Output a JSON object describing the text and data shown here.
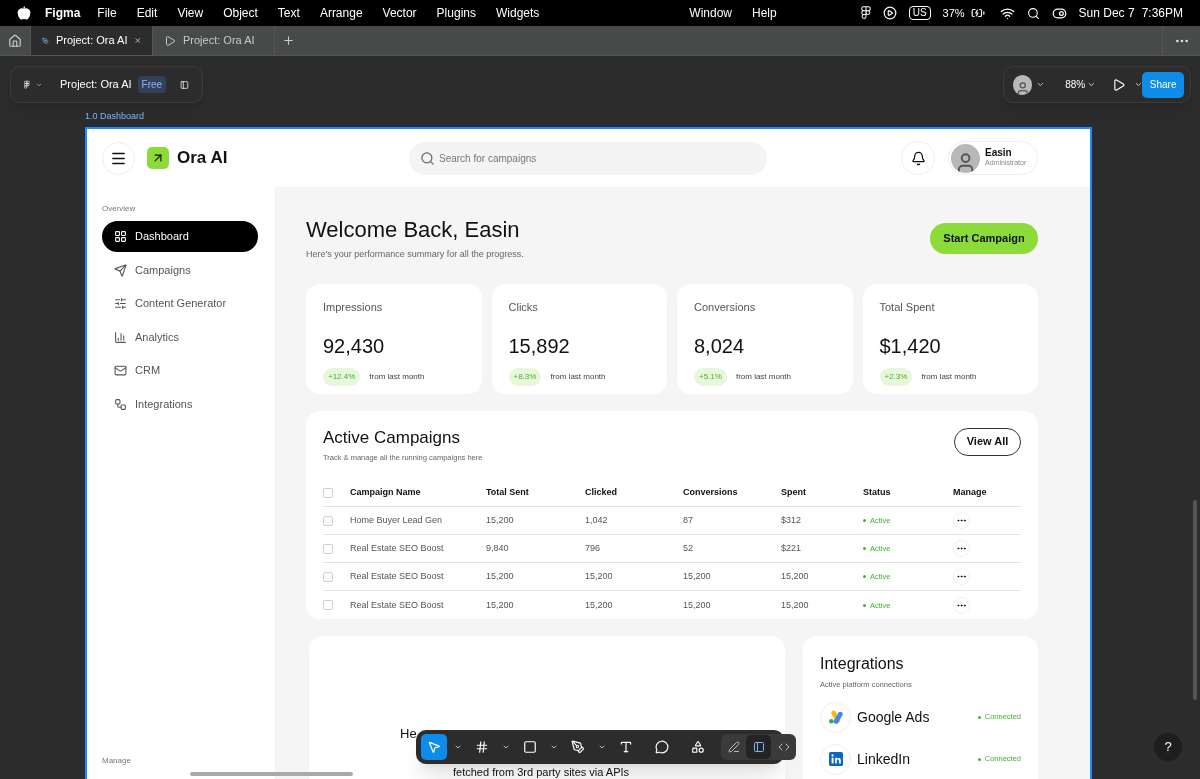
{
  "menu_bar": {
    "app": "Figma",
    "menus": [
      "File",
      "Edit",
      "View",
      "Object",
      "Text",
      "Arrange",
      "Vector",
      "Plugins",
      "Widgets",
      "Window",
      "Help"
    ],
    "keyboard": "US",
    "battery": "37%",
    "date": "Sun Dec 7",
    "time": "7:36PM"
  },
  "tabs": [
    {
      "label": "Project: Ora AI",
      "selected": true,
      "kind": "design"
    },
    {
      "label": "Project: Ora AI",
      "selected": false,
      "kind": "prototype"
    }
  ],
  "file_panel": {
    "title": "Project: Ora AI",
    "plan": "Free"
  },
  "view_panel": {
    "zoom": "88%",
    "share": "Share"
  },
  "frame_label": "1.0 Dashboard",
  "app": {
    "brand": "Ora AI",
    "search": {
      "placeholder": "Search for campaigns"
    },
    "user": {
      "name": "Easin",
      "role": "Administrator"
    },
    "sidebar": {
      "section": "Overview",
      "items": [
        {
          "label": "Dashboard",
          "selected": true
        },
        {
          "label": "Campaigns",
          "selected": false
        },
        {
          "label": "Content Generator",
          "selected": false
        },
        {
          "label": "Analytics",
          "selected": false
        },
        {
          "label": "CRM",
          "selected": false
        },
        {
          "label": "Integrations",
          "selected": false
        }
      ],
      "footer_section": "Manage"
    },
    "welcome": {
      "title": "Welcome Back, Easin",
      "subtitle": "Here's your performance summary for all the progress.",
      "action": "Start Campaign"
    },
    "stats": [
      {
        "label": "Impressions",
        "value": "92,430",
        "change": "+12.4%",
        "note": "from last month"
      },
      {
        "label": "Clicks",
        "value": "15,892",
        "change": "+8.3%",
        "note": "from last month"
      },
      {
        "label": "Conversions",
        "value": "8,024",
        "change": "+5.1%",
        "note": "from last month"
      },
      {
        "label": "Total Spent",
        "value": "$1,420",
        "change": "+2.3%",
        "note": "from last month"
      }
    ],
    "campaigns": {
      "title": "Active Campaigns",
      "subtitle": "Track & manage all the running campaigns here",
      "action": "View All",
      "columns": [
        "Campaign Name",
        "Total Sent",
        "Clicked",
        "Conversions",
        "Spent",
        "Status",
        "Manage"
      ],
      "all_checked": false,
      "rows": [
        {
          "checked": false,
          "cells": [
            "Home Buyer Lead Gen",
            "15,200",
            "1,042",
            "87",
            "$312"
          ],
          "status": "Active"
        },
        {
          "checked": false,
          "cells": [
            "Real Estate SEO Boost",
            "9,840",
            "796",
            "52",
            "$221"
          ],
          "status": "Active"
        },
        {
          "checked": false,
          "cells": [
            "Real Estate SEO Boost",
            "15,200",
            "15,200",
            "15,200",
            "15,200"
          ],
          "status": "Active"
        },
        {
          "checked": false,
          "cells": [
            "Real Estate SEO Boost",
            "15,200",
            "15,200",
            "15,200",
            "15,200"
          ],
          "status": "Active"
        }
      ]
    },
    "partial_card": {
      "lines": [
        "He",
        "fetched from 3rd party sites via APIs"
      ]
    },
    "integrations": {
      "title": "Integrations",
      "subtitle": "Active platform connections",
      "items": [
        {
          "name": "Google Ads",
          "status": "Connected",
          "kind": "google"
        },
        {
          "name": "LinkedIn",
          "status": "Connected",
          "kind": "linkedin"
        }
      ]
    }
  },
  "toolbar": {
    "tools": [
      {
        "kind": "move",
        "selected": true
      },
      {
        "kind": "frame",
        "selected": false
      },
      {
        "kind": "shape",
        "selected": false
      },
      {
        "kind": "pen",
        "selected": false
      },
      {
        "kind": "text",
        "selected": false
      },
      {
        "kind": "comment",
        "selected": false
      },
      {
        "kind": "actions",
        "selected": false
      }
    ],
    "modes": [
      {
        "kind": "draw",
        "selected": false
      },
      {
        "kind": "design",
        "selected": true
      },
      {
        "kind": "dev",
        "selected": false
      }
    ]
  },
  "help": "?"
}
